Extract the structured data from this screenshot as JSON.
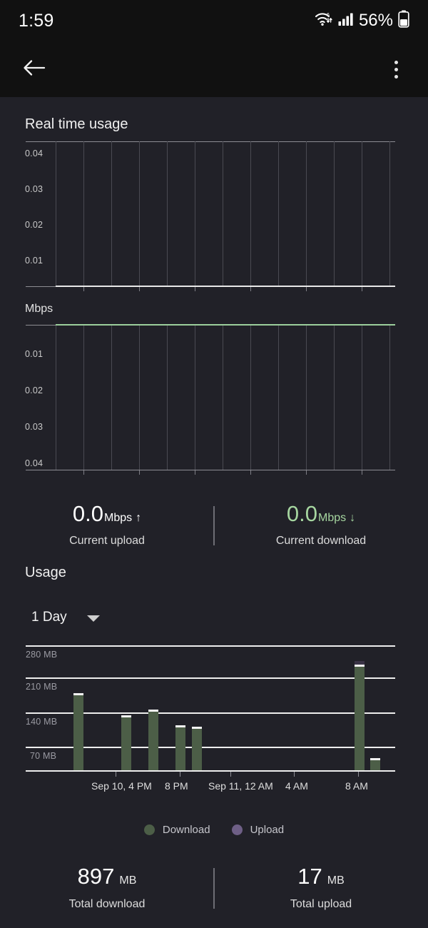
{
  "statusbar": {
    "time": "1:59",
    "battery_percent": "56%",
    "icons": [
      "wifi-6-icon",
      "cellular-signal-icon",
      "battery-icon"
    ]
  },
  "appbar": {
    "back_icon": "back-arrow-icon",
    "overflow_icon": "more-vertical-icon"
  },
  "realtime": {
    "title": "Real time usage",
    "unit_label": "Mbps",
    "upload_chart": {
      "yticks": [
        "0.04",
        "0.03",
        "0.02",
        "0.01"
      ]
    },
    "download_chart": {
      "yticks": [
        "0.01",
        "0.02",
        "0.03",
        "0.04"
      ]
    }
  },
  "current": {
    "upload": {
      "value": "0.0",
      "unit": "Mbps",
      "arrow": "↑",
      "label": "Current upload",
      "color": "#ffffff"
    },
    "download": {
      "value": "0.0",
      "unit": "Mbps",
      "arrow": "↓",
      "label": "Current download",
      "color": "#a6d6a0"
    }
  },
  "usage": {
    "title": "Usage",
    "range_selected": "1 Day",
    "caret_icon": "chevron-down-icon"
  },
  "totals": {
    "download": {
      "value": "897",
      "unit": "MB",
      "label": "Total download"
    },
    "upload": {
      "value": "17",
      "unit": "MB",
      "label": "Total upload"
    }
  },
  "legend": [
    {
      "label": "Download",
      "color": "#4c5e47"
    },
    {
      "label": "Upload",
      "color": "#6e5f86"
    }
  ],
  "chart_data": {
    "type": "bar",
    "title": "Usage",
    "xlabel": "",
    "ylabel": "MB",
    "ylim": [
      0,
      320
    ],
    "yticks": [
      70,
      140,
      210,
      280
    ],
    "ytick_labels": [
      "70 MB",
      "140 MB",
      "210 MB",
      "280 MB"
    ],
    "xtick_labels": [
      "Sep 10, 4 PM",
      "8 PM",
      "Sep 11, 12 AM",
      "4 AM",
      "8 AM"
    ],
    "grid": true,
    "legend_position": "bottom",
    "series": [
      {
        "name": "Download",
        "color": "#4c5e47",
        "values": [
          195,
          138,
          152,
          113,
          110,
          268,
          22
        ]
      },
      {
        "name": "Upload",
        "color": "#6e5f86",
        "values": [
          2,
          1,
          2,
          1,
          1,
          6,
          1
        ]
      }
    ],
    "bar_times": [
      "Sep 10, 2 PM",
      "Sep 10, 6 PM",
      "Sep 10, 7 PM",
      "Sep 10, 9 PM",
      "Sep 10, 10 PM",
      "Sep 11, 8 AM",
      "Sep 11, 9 AM"
    ],
    "total_download": "897 MB",
    "total_upload": "17 MB"
  },
  "realtime_chart_data": [
    {
      "type": "line",
      "name": "Upload",
      "ylabel": "Mbps",
      "ylim": [
        0,
        0.045
      ],
      "yticks": [
        0.01,
        0.02,
        0.03,
        0.04
      ],
      "values": [
        0,
        0,
        0,
        0,
        0,
        0,
        0,
        0,
        0,
        0,
        0,
        0,
        0
      ],
      "color": "#e9e9e9",
      "grid": true
    },
    {
      "type": "line",
      "name": "Download",
      "ylabel": "Mbps",
      "ylim": [
        0,
        0.045
      ],
      "yticks": [
        0.01,
        0.02,
        0.03,
        0.04
      ],
      "inverted": true,
      "values": [
        0,
        0,
        0,
        0,
        0,
        0,
        0,
        0,
        0,
        0,
        0,
        0,
        0
      ],
      "color": "#9ccf9c",
      "grid": true
    }
  ]
}
